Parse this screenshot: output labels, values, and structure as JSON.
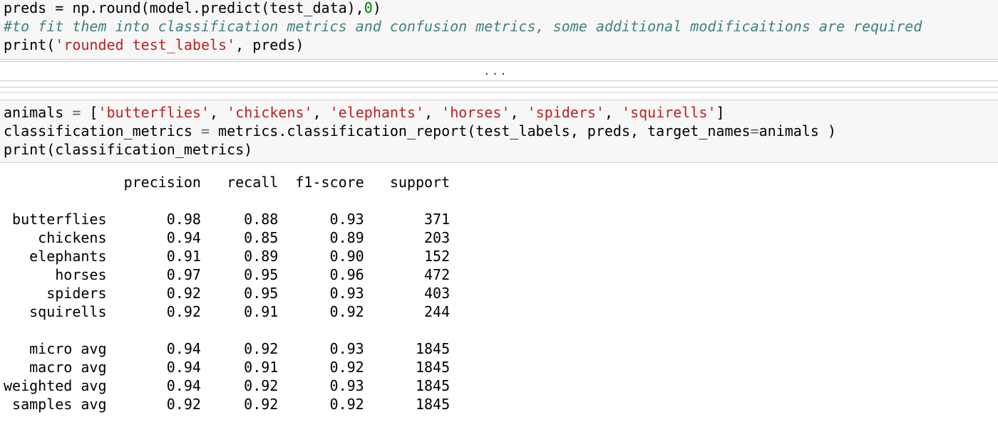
{
  "cell1": {
    "line1": {
      "a": "preds = np.round(model.predict(test_data),",
      "num": "0",
      "b": ")"
    },
    "comment": "#to fit them into classification metrics and confusion metrics, some additional modificaitions are required",
    "line3": {
      "a": "print(",
      "str": "'rounded test_labels'",
      "b": ", preds)"
    }
  },
  "collapsed_output": {
    "label": "..."
  },
  "cell2": {
    "line1": {
      "a": "animals ",
      "eq": "=",
      "b": " [",
      "s1": "'butterflies'",
      "s2": "'chickens'",
      "s3": "'elephants'",
      "s4": "'horses'",
      "s5": "'spiders'",
      "s6": "'squirells'",
      "sep": ", ",
      "c": "]"
    },
    "line2": {
      "a": "classification_metrics ",
      "eq": "=",
      "b": " metrics.classification_report(test_labels, preds, target_names",
      "eq2": "=",
      "c": "animals )"
    },
    "line3": "print(classification_metrics)"
  },
  "report": {
    "header": [
      "precision",
      "recall",
      "f1-score",
      "support"
    ],
    "rows": [
      [
        "butterflies",
        "0.98",
        "0.88",
        "0.93",
        "371"
      ],
      [
        "chickens",
        "0.94",
        "0.85",
        "0.89",
        "203"
      ],
      [
        "elephants",
        "0.91",
        "0.89",
        "0.90",
        "152"
      ],
      [
        "horses",
        "0.97",
        "0.95",
        "0.96",
        "472"
      ],
      [
        "spiders",
        "0.92",
        "0.95",
        "0.93",
        "403"
      ],
      [
        "squirells",
        "0.92",
        "0.91",
        "0.92",
        "244"
      ]
    ],
    "averages": [
      [
        "micro avg",
        "0.94",
        "0.92",
        "0.93",
        "1845"
      ],
      [
        "macro avg",
        "0.94",
        "0.91",
        "0.92",
        "1845"
      ],
      [
        "weighted avg",
        "0.94",
        "0.92",
        "0.93",
        "1845"
      ],
      [
        "samples avg",
        "0.92",
        "0.92",
        "0.92",
        "1845"
      ]
    ]
  }
}
